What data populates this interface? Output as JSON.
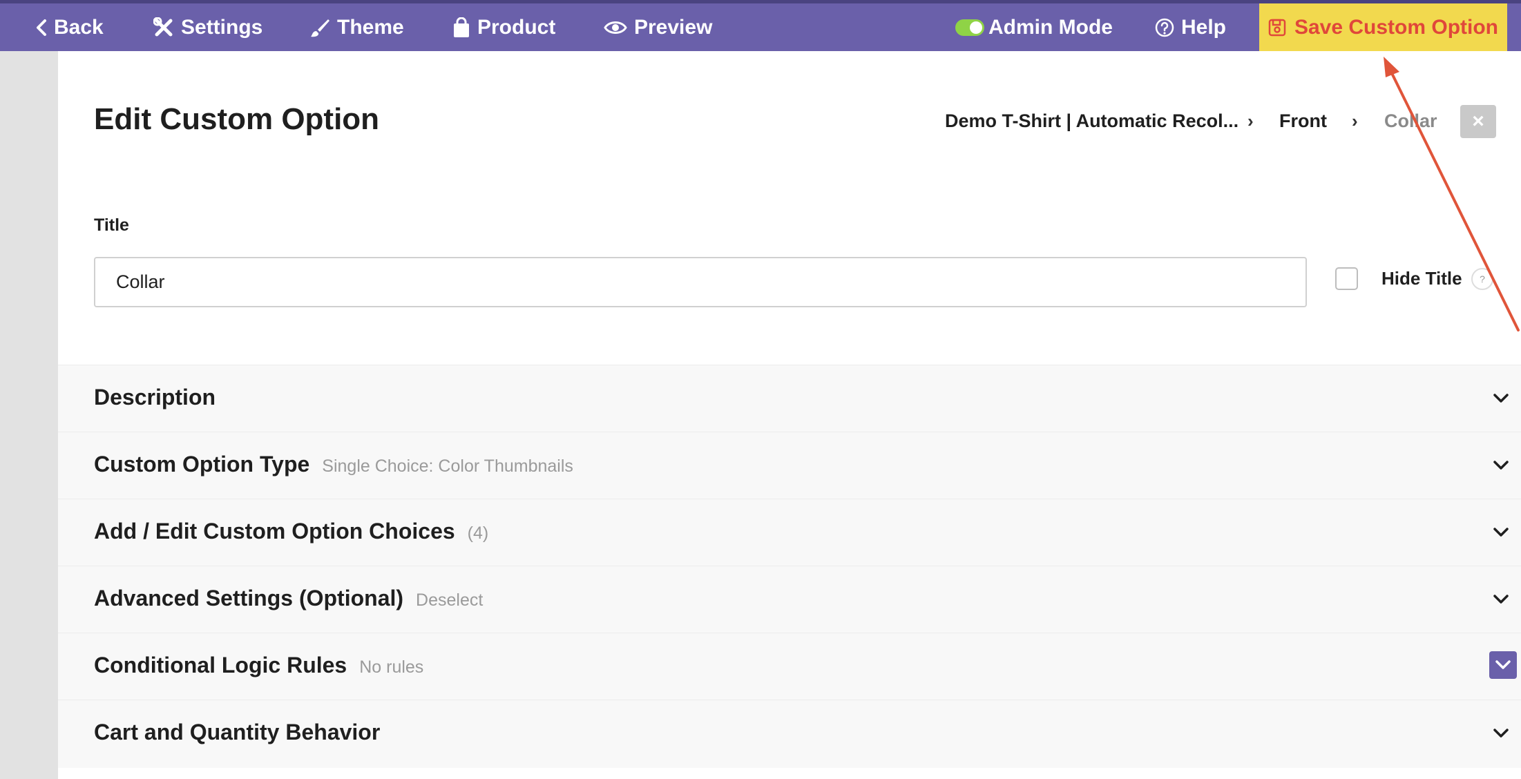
{
  "nav": {
    "back": "Back",
    "settings": "Settings",
    "theme": "Theme",
    "product": "Product",
    "preview": "Preview",
    "admin_mode": "Admin Mode",
    "help": "Help",
    "save": "Save Custom Option"
  },
  "page": {
    "title": "Edit Custom Option",
    "breadcrumb": [
      "Demo T-Shirt | Automatic Recol...",
      "Front",
      "Collar"
    ],
    "close": "×"
  },
  "form": {
    "title_label": "Title",
    "title_value": "Collar",
    "hide_title_label": "Hide Title",
    "help_mark": "?"
  },
  "sections": [
    {
      "title": "Description",
      "sub": ""
    },
    {
      "title": "Custom Option Type",
      "sub": "Single Choice: Color Thumbnails"
    },
    {
      "title": "Add / Edit Custom Option Choices",
      "sub": "(4)"
    },
    {
      "title": "Advanced Settings (Optional)",
      "sub": "Deselect"
    },
    {
      "title": "Conditional Logic Rules",
      "sub": "No rules"
    },
    {
      "title": "Cart and Quantity Behavior",
      "sub": ""
    }
  ],
  "colors": {
    "topbar": "#6a60aa",
    "save_bg": "#f2d94e",
    "save_text": "#e0473a",
    "toggle_on": "#8fd346",
    "annotation_arrow": "#e0553a"
  },
  "icons": [
    "chevron-left-icon",
    "tools-icon",
    "brush-icon",
    "shopping-bag-icon",
    "eye-icon",
    "toggle-icon",
    "question-circle-icon",
    "save-icon",
    "chevron-down-icon",
    "close-icon"
  ]
}
